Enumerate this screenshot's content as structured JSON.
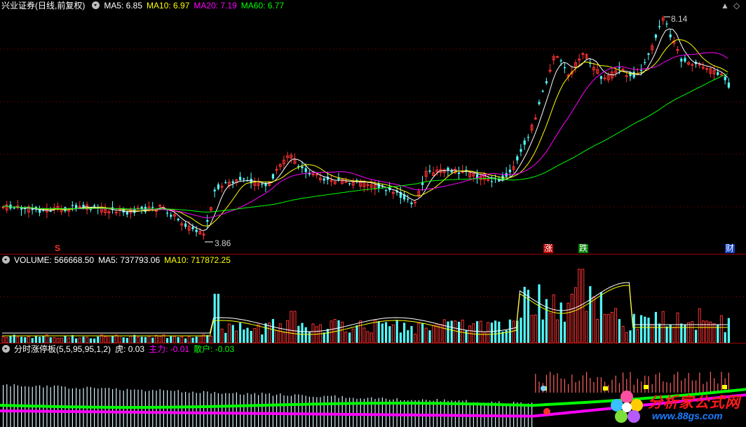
{
  "main": {
    "title": "兴业证券(日线,前复权)",
    "ma": [
      {
        "label": "MA5: 6.85",
        "color": "#ffffff"
      },
      {
        "label": "MA10: 6.97",
        "color": "#ffff00"
      },
      {
        "label": "MA20: 7.19",
        "color": "#ff00ff"
      },
      {
        "label": "MA60: 6.77",
        "color": "#00ff00"
      }
    ],
    "high_label": "8.14",
    "low_label": "3.86",
    "tags": {
      "s": "S",
      "zhang": "涨",
      "die": "跌",
      "cai": "财"
    },
    "ctrl_up": "▲",
    "ctrl_diamond": "◇"
  },
  "volume": {
    "title": "VOLUME: 566668.50",
    "ma5": "MA5: 737793.06",
    "ma10": "MA10: 717872.25"
  },
  "indicator": {
    "title": "分时涨停板(5,5,95,95,1,2)",
    "hu": "虎: 0.03",
    "zhuli": "主力: -0.01",
    "sanhu": "散户: -0.03"
  },
  "watermark": {
    "text": "分析家公式网",
    "url": "www.88gs.com"
  },
  "colors": {
    "up": "#ff3232",
    "down": "#54ffff",
    "ma5": "#ffffff",
    "ma10": "#ffff00",
    "ma20": "#ff00ff",
    "ma60": "#00ff00",
    "grid": "#9a0000"
  }
}
